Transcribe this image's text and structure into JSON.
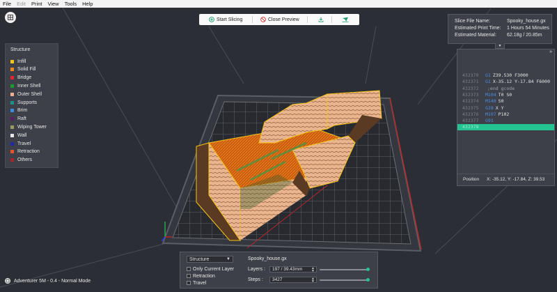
{
  "menu": [
    "File",
    "Edit",
    "Print",
    "View",
    "Tools",
    "Help"
  ],
  "toolbar": {
    "start_slicing": "Start Slicing",
    "close_preview": "Close Preview"
  },
  "legend": {
    "title": "Structure",
    "items": [
      {
        "label": "Infill",
        "color": "#f5c518"
      },
      {
        "label": "Solid Fill",
        "color": "#f0861e"
      },
      {
        "label": "Bridge",
        "color": "#e6262d"
      },
      {
        "label": "Inner Shell",
        "color": "#1a9a2e"
      },
      {
        "label": "Outer Shell",
        "color": "#f2b08e"
      },
      {
        "label": "Supports",
        "color": "#1e8f8a"
      },
      {
        "label": "Brim",
        "color": "#3c8de0"
      },
      {
        "label": "Raft",
        "color": "#5a1e66"
      },
      {
        "label": "Wiping Tower",
        "color": "#9a9a62"
      },
      {
        "label": "Wall",
        "color": "#e8e8e8"
      },
      {
        "label": "Travel",
        "color": "#1e2aa8"
      },
      {
        "label": "Retraction",
        "color": "#e8532a"
      },
      {
        "label": "Others",
        "color": "#a8262a"
      }
    ]
  },
  "info": {
    "file_label": "Slice File Name:",
    "file_value": "Spooky_house.gx",
    "time_label": "Estimated Print Time:",
    "time_value": "1 Hours 54 Minutes",
    "material_label": "Estimated Material:",
    "material_value": "62.18g / 20.85m"
  },
  "gcode": {
    "lines": [
      {
        "num": "432370",
        "op": "G1",
        "args": "Z39.530 F3000"
      },
      {
        "num": "432371",
        "op": "G1",
        "args": "X-35.12 Y-17.84 F6000"
      },
      {
        "num": "432372",
        "op": "",
        "args": ";end gcode"
      },
      {
        "num": "432373",
        "op": "M104",
        "args": "T0 S0"
      },
      {
        "num": "432374",
        "op": "M140",
        "args": "S0"
      },
      {
        "num": "432375",
        "op": "G28",
        "args": "X Y"
      },
      {
        "num": "432376",
        "op": "M107",
        "args": "P102"
      },
      {
        "num": "432377",
        "op": "G91",
        "args": ""
      },
      {
        "num": "432378",
        "op": "",
        "args": ""
      }
    ],
    "active_index": 8,
    "position_label": "Position",
    "position_value": "X: -35.12, Y: -17.84, Z: 39.53"
  },
  "bottom": {
    "structure_select": "Structure",
    "only_current_layer": "Only Current Layer",
    "retraction": "Retraction",
    "travel": "Travel",
    "file_name": "Spooky_house.gx",
    "layers_label": "Layers :",
    "layers_value": "197 / 39.43mm",
    "steps_label": "Steps :",
    "steps_value": "3427",
    "layers_slider_fraction": 1.0,
    "steps_slider_fraction": 1.0
  },
  "status": "Adventurer 5M - 0.4 - Normal Mode"
}
